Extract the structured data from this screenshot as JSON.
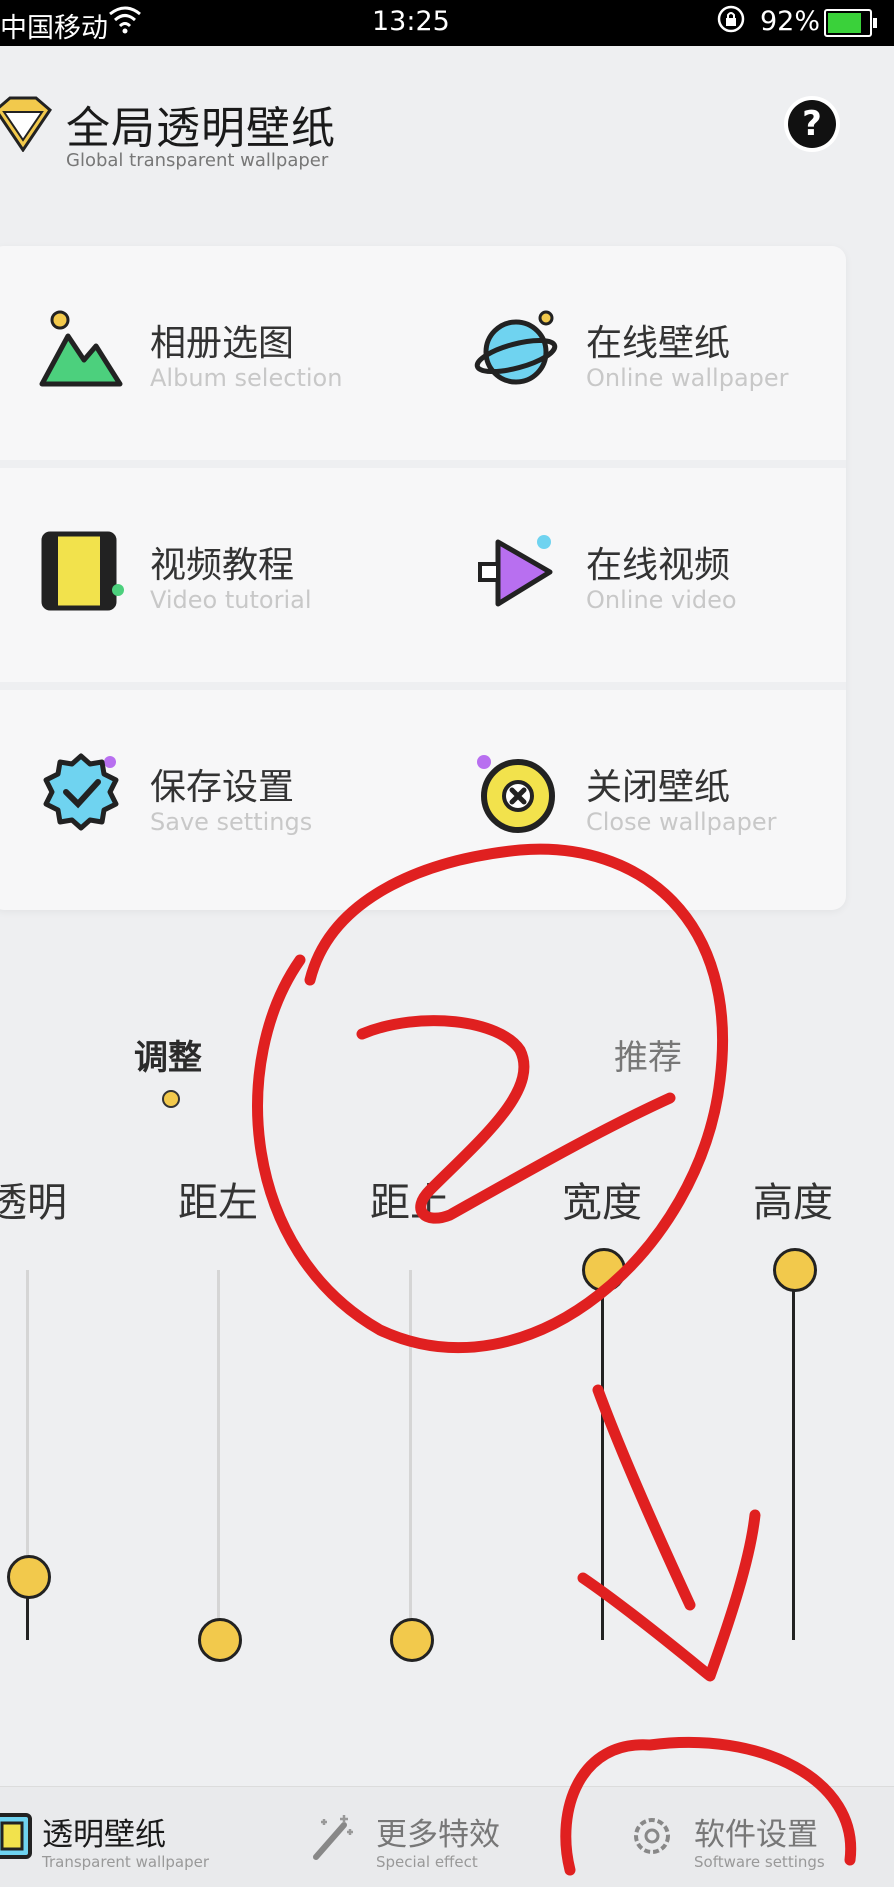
{
  "status_bar": {
    "carrier": "中国移动",
    "time": "13:25",
    "battery": "92%",
    "battery_level": 0.92
  },
  "header": {
    "title": "全局透明壁纸",
    "subtitle": "Global transparent wallpaper",
    "help_label": "?"
  },
  "menu": {
    "album": {
      "label": "相册选图",
      "sublabel": "Album selection",
      "icon": "mountain-photo-icon"
    },
    "online_wallpaper": {
      "label": "在线壁纸",
      "sublabel": "Online wallpaper",
      "icon": "planet-icon"
    },
    "video_tutorial": {
      "label": "视频教程",
      "sublabel": "Video tutorial",
      "icon": "film-icon"
    },
    "online_video": {
      "label": "在线视频",
      "sublabel": "Online video",
      "icon": "play-icon"
    },
    "save_settings": {
      "label": "保存设置",
      "sublabel": "Save settings",
      "icon": "badge-check-icon"
    },
    "close_wallpaper": {
      "label": "关闭壁纸",
      "sublabel": "Close wallpaper",
      "icon": "close-circle-icon"
    }
  },
  "tabs": {
    "adjust": "调整",
    "recommend": "推荐"
  },
  "sliders": [
    {
      "label": "透明",
      "value": 0.17
    },
    {
      "label": "距左",
      "value": 0.0
    },
    {
      "label": "距上",
      "value": 0.0
    },
    {
      "label": "宽度",
      "value": 1.0
    },
    {
      "label": "高度",
      "value": 1.0
    }
  ],
  "bottom_nav": {
    "transparent": {
      "label": "透明壁纸",
      "sublabel": "Transparent wallpaper",
      "icon": "wallpaper-icon"
    },
    "effects": {
      "label": "更多特效",
      "sublabel": "Special effect",
      "icon": "magic-wand-icon"
    },
    "settings": {
      "label": "软件设置",
      "sublabel": "Software settings",
      "icon": "gear-icon"
    }
  },
  "colors": {
    "accent": "#f2c94c",
    "annotation_red": "#e02020"
  }
}
